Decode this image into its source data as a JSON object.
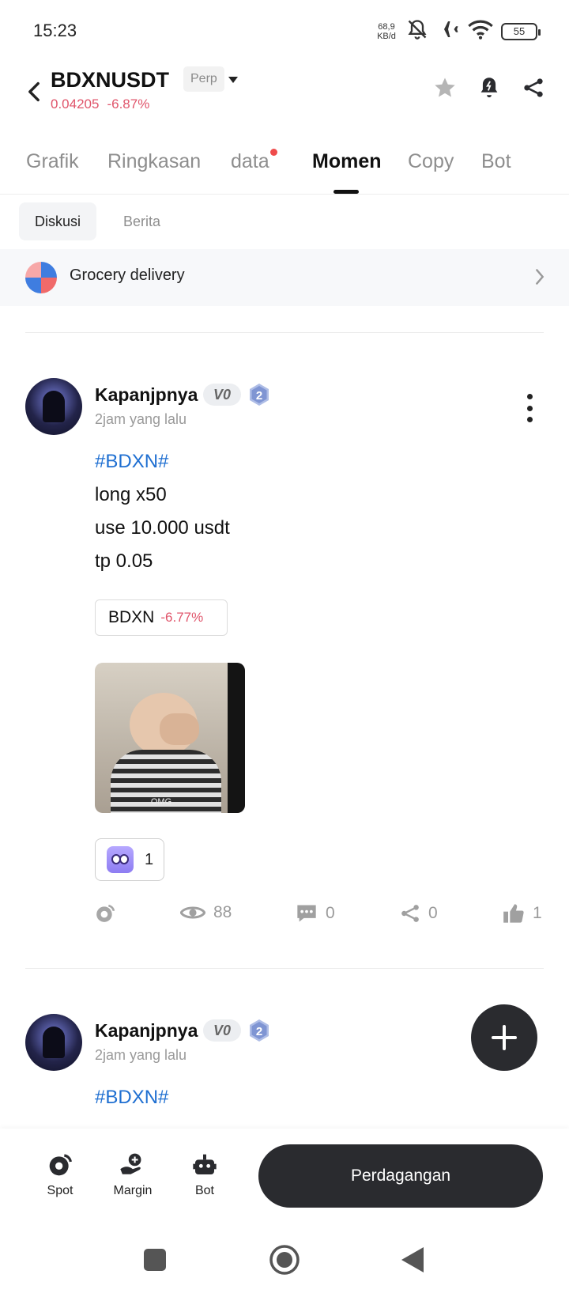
{
  "status_bar": {
    "time": "15:23",
    "net_speed": "68,9",
    "net_unit": "KB/d",
    "battery": "55"
  },
  "header": {
    "pair": "BDXNUSDT",
    "contract_type": "Perp",
    "price": "0.04205",
    "change": "-6.87%"
  },
  "tabs": [
    {
      "label": "Grafik"
    },
    {
      "label": "Ringkasan"
    },
    {
      "label": "data"
    },
    {
      "label": "Momen"
    },
    {
      "label": "Copy"
    },
    {
      "label": "Bot"
    }
  ],
  "sub_tabs": [
    {
      "label": "Diskusi"
    },
    {
      "label": "Berita"
    }
  ],
  "promo": {
    "text": "Grocery delivery"
  },
  "posts": [
    {
      "username": "Kapanjpnya",
      "vip": "V0",
      "level": "2",
      "time": "2jam yang lalu",
      "hashtag": "#BDXN#",
      "lines": [
        "long x50",
        "use 10.000 usdt",
        "tp 0.05"
      ],
      "coin_chip": {
        "symbol": "BDXN",
        "change": "-6.77%"
      },
      "gif_caption": "OMG",
      "reaction_count": "1",
      "stats": {
        "views": "88",
        "comments": "0",
        "shares": "0",
        "likes": "1"
      }
    },
    {
      "username": "Kapanjpnya",
      "vip": "V0",
      "level": "2",
      "time": "2jam yang lalu",
      "hashtag": "#BDXN#"
    }
  ],
  "bottom_nav": [
    {
      "label": "Spot"
    },
    {
      "label": "Margin"
    },
    {
      "label": "Bot"
    }
  ],
  "trade_button": "Perdagangan",
  "colors": {
    "negative": "#e0556b",
    "hashtag": "#1f6fd1",
    "dark_button": "#2a2b2f"
  }
}
